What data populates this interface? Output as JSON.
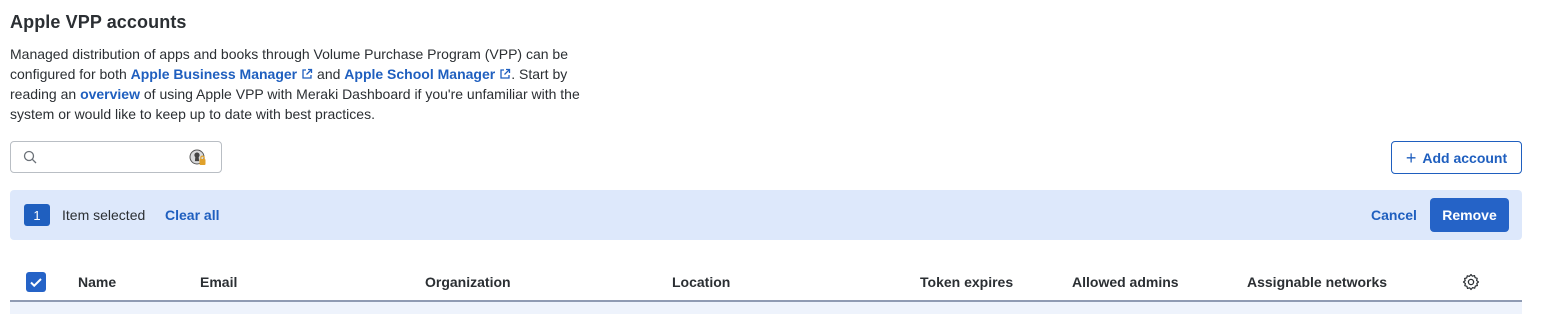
{
  "page": {
    "title": "Apple VPP accounts"
  },
  "description": {
    "part1": "Managed distribution of apps and books through Volume Purchase Program (VPP) can be configured for both ",
    "link_business": "Apple Business Manager",
    "part2": " and ",
    "link_school": "Apple School Manager",
    "part3": ". Start by reading an ",
    "link_overview": "overview",
    "part4": " of using Apple VPP with Meraki Dashboard if you're unfamiliar with the system or would like to keep up to date with best practices."
  },
  "search": {
    "value": "",
    "placeholder": "",
    "icon": "search-icon",
    "extension_icon": "password-manager-icon"
  },
  "toolbar": {
    "add_icon": "plus-icon",
    "add_label": "Add account"
  },
  "selection": {
    "count": "1",
    "label": "Item selected",
    "clear_all": "Clear all",
    "cancel": "Cancel",
    "remove": "Remove"
  },
  "table": {
    "select_all_checked": true,
    "columns": [
      "Name",
      "Email",
      "Organization",
      "Location",
      "Token expires",
      "Allowed admins",
      "Assignable networks"
    ],
    "settings_icon": "gear-icon"
  },
  "colors": {
    "accent": "#1f5fbf",
    "primary_button": "#2563c7",
    "selection_bar": "#dde8fb",
    "text": "#2b2f33"
  }
}
